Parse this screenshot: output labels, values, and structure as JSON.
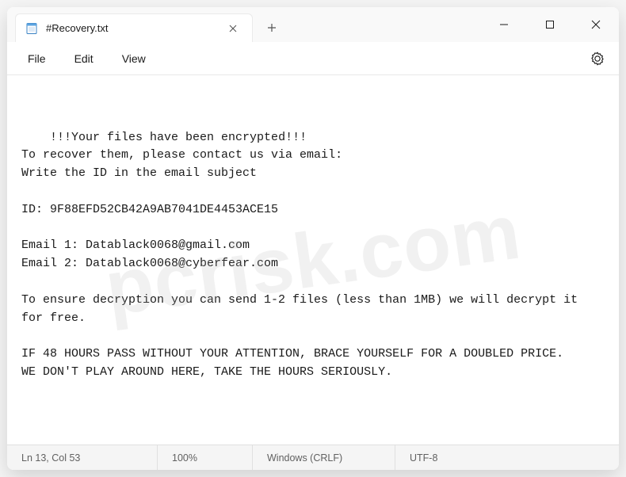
{
  "window": {
    "tab_title": "#Recovery.txt"
  },
  "menu": {
    "file": "File",
    "edit": "Edit",
    "view": "View"
  },
  "content": {
    "text": "!!!Your files have been encrypted!!!\nTo recover them, please contact us via email:\nWrite the ID in the email subject\n\nID: 9F88EFD52CB42A9AB7041DE4453ACE15\n\nEmail 1: Datablack0068@gmail.com\nEmail 2: Datablack0068@cyberfear.com\n\nTo ensure decryption you can send 1-2 files (less than 1MB) we will decrypt it for free.\n\nIF 48 HOURS PASS WITHOUT YOUR ATTENTION, BRACE YOURSELF FOR A DOUBLED PRICE.\nWE DON'T PLAY AROUND HERE, TAKE THE HOURS SERIOUSLY."
  },
  "statusbar": {
    "position": "Ln 13, Col 53",
    "zoom": "100%",
    "line_ending": "Windows (CRLF)",
    "encoding": "UTF-8"
  },
  "watermark": "pcrisk.com"
}
